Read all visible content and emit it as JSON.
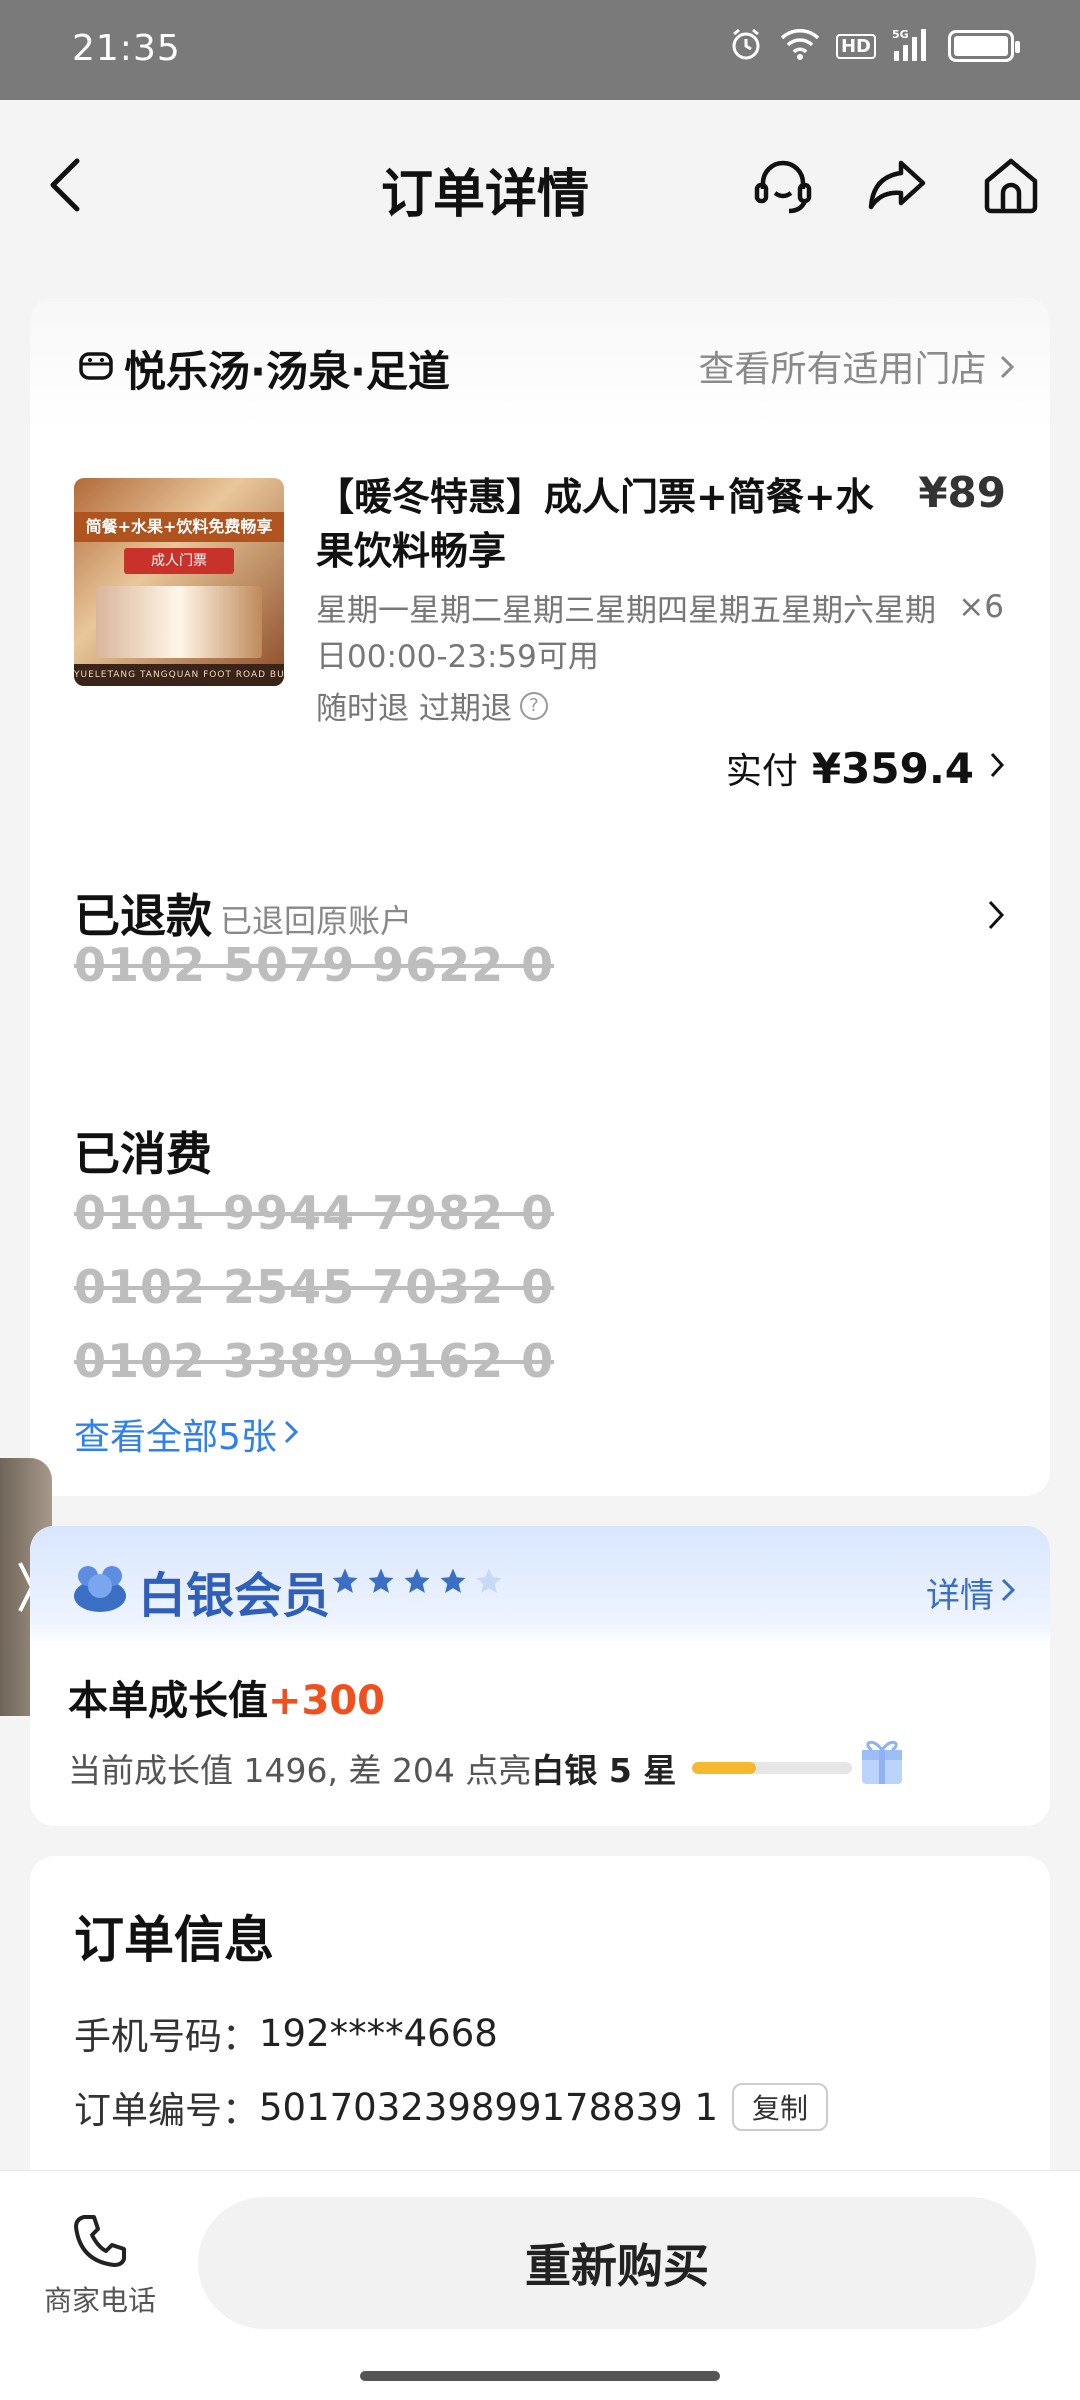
{
  "status_bar": {
    "time": "21:35",
    "hd": "HD",
    "network": "5G"
  },
  "nav": {
    "title": "订单详情"
  },
  "shop": {
    "name": "悦乐汤·汤泉·足道",
    "link": "查看所有适用门店"
  },
  "product": {
    "image_band": "简餐+水果+饮料免费畅享",
    "image_tag": "成人门票",
    "image_footer": "YUELETANG TANGQUAN FOOT ROAD BUFFET",
    "title": "【暖冬特惠】成人门票+简餐+水果饮料畅享",
    "price": "¥89",
    "validity": "星期一星期二星期三星期四星期五星期六星期日00:00-23:59可用",
    "quantity": "×6",
    "refund": "随时退 过期退",
    "paid_label": "实付",
    "paid_amount": "¥359.4"
  },
  "refunded": {
    "title": "已退款",
    "sub": "已退回原账户",
    "codes": [
      "0102 5079 9622 0"
    ]
  },
  "consumed": {
    "title": "已消费",
    "codes": [
      "0101 9944 7982 0",
      "0102 2545 7032 0",
      "0102 3389 9162 0"
    ],
    "view_all": "查看全部5张"
  },
  "member": {
    "level": "白银会员",
    "stars_filled": 4,
    "stars_total": 5,
    "detail": "详情",
    "growth_label": "本单成长值",
    "growth_plus": "+300",
    "desc_prefix": "当前成长值 1496, 差 204 点亮",
    "desc_bold": "白银 5 星",
    "progress_fraction": 0.4,
    "colors": {
      "accent": "#2f5fb8",
      "plus": "#f0501e",
      "progress": "#f5b82e"
    }
  },
  "order_info": {
    "title": "订单信息",
    "rows": [
      {
        "k": "手机号码：",
        "v": "192****4668"
      },
      {
        "k": "订单编号：",
        "v": "501703239899178839 1"
      }
    ],
    "copy": "复制"
  },
  "bottom": {
    "phone_label": "商家电话",
    "rebuy": "重新购买"
  }
}
